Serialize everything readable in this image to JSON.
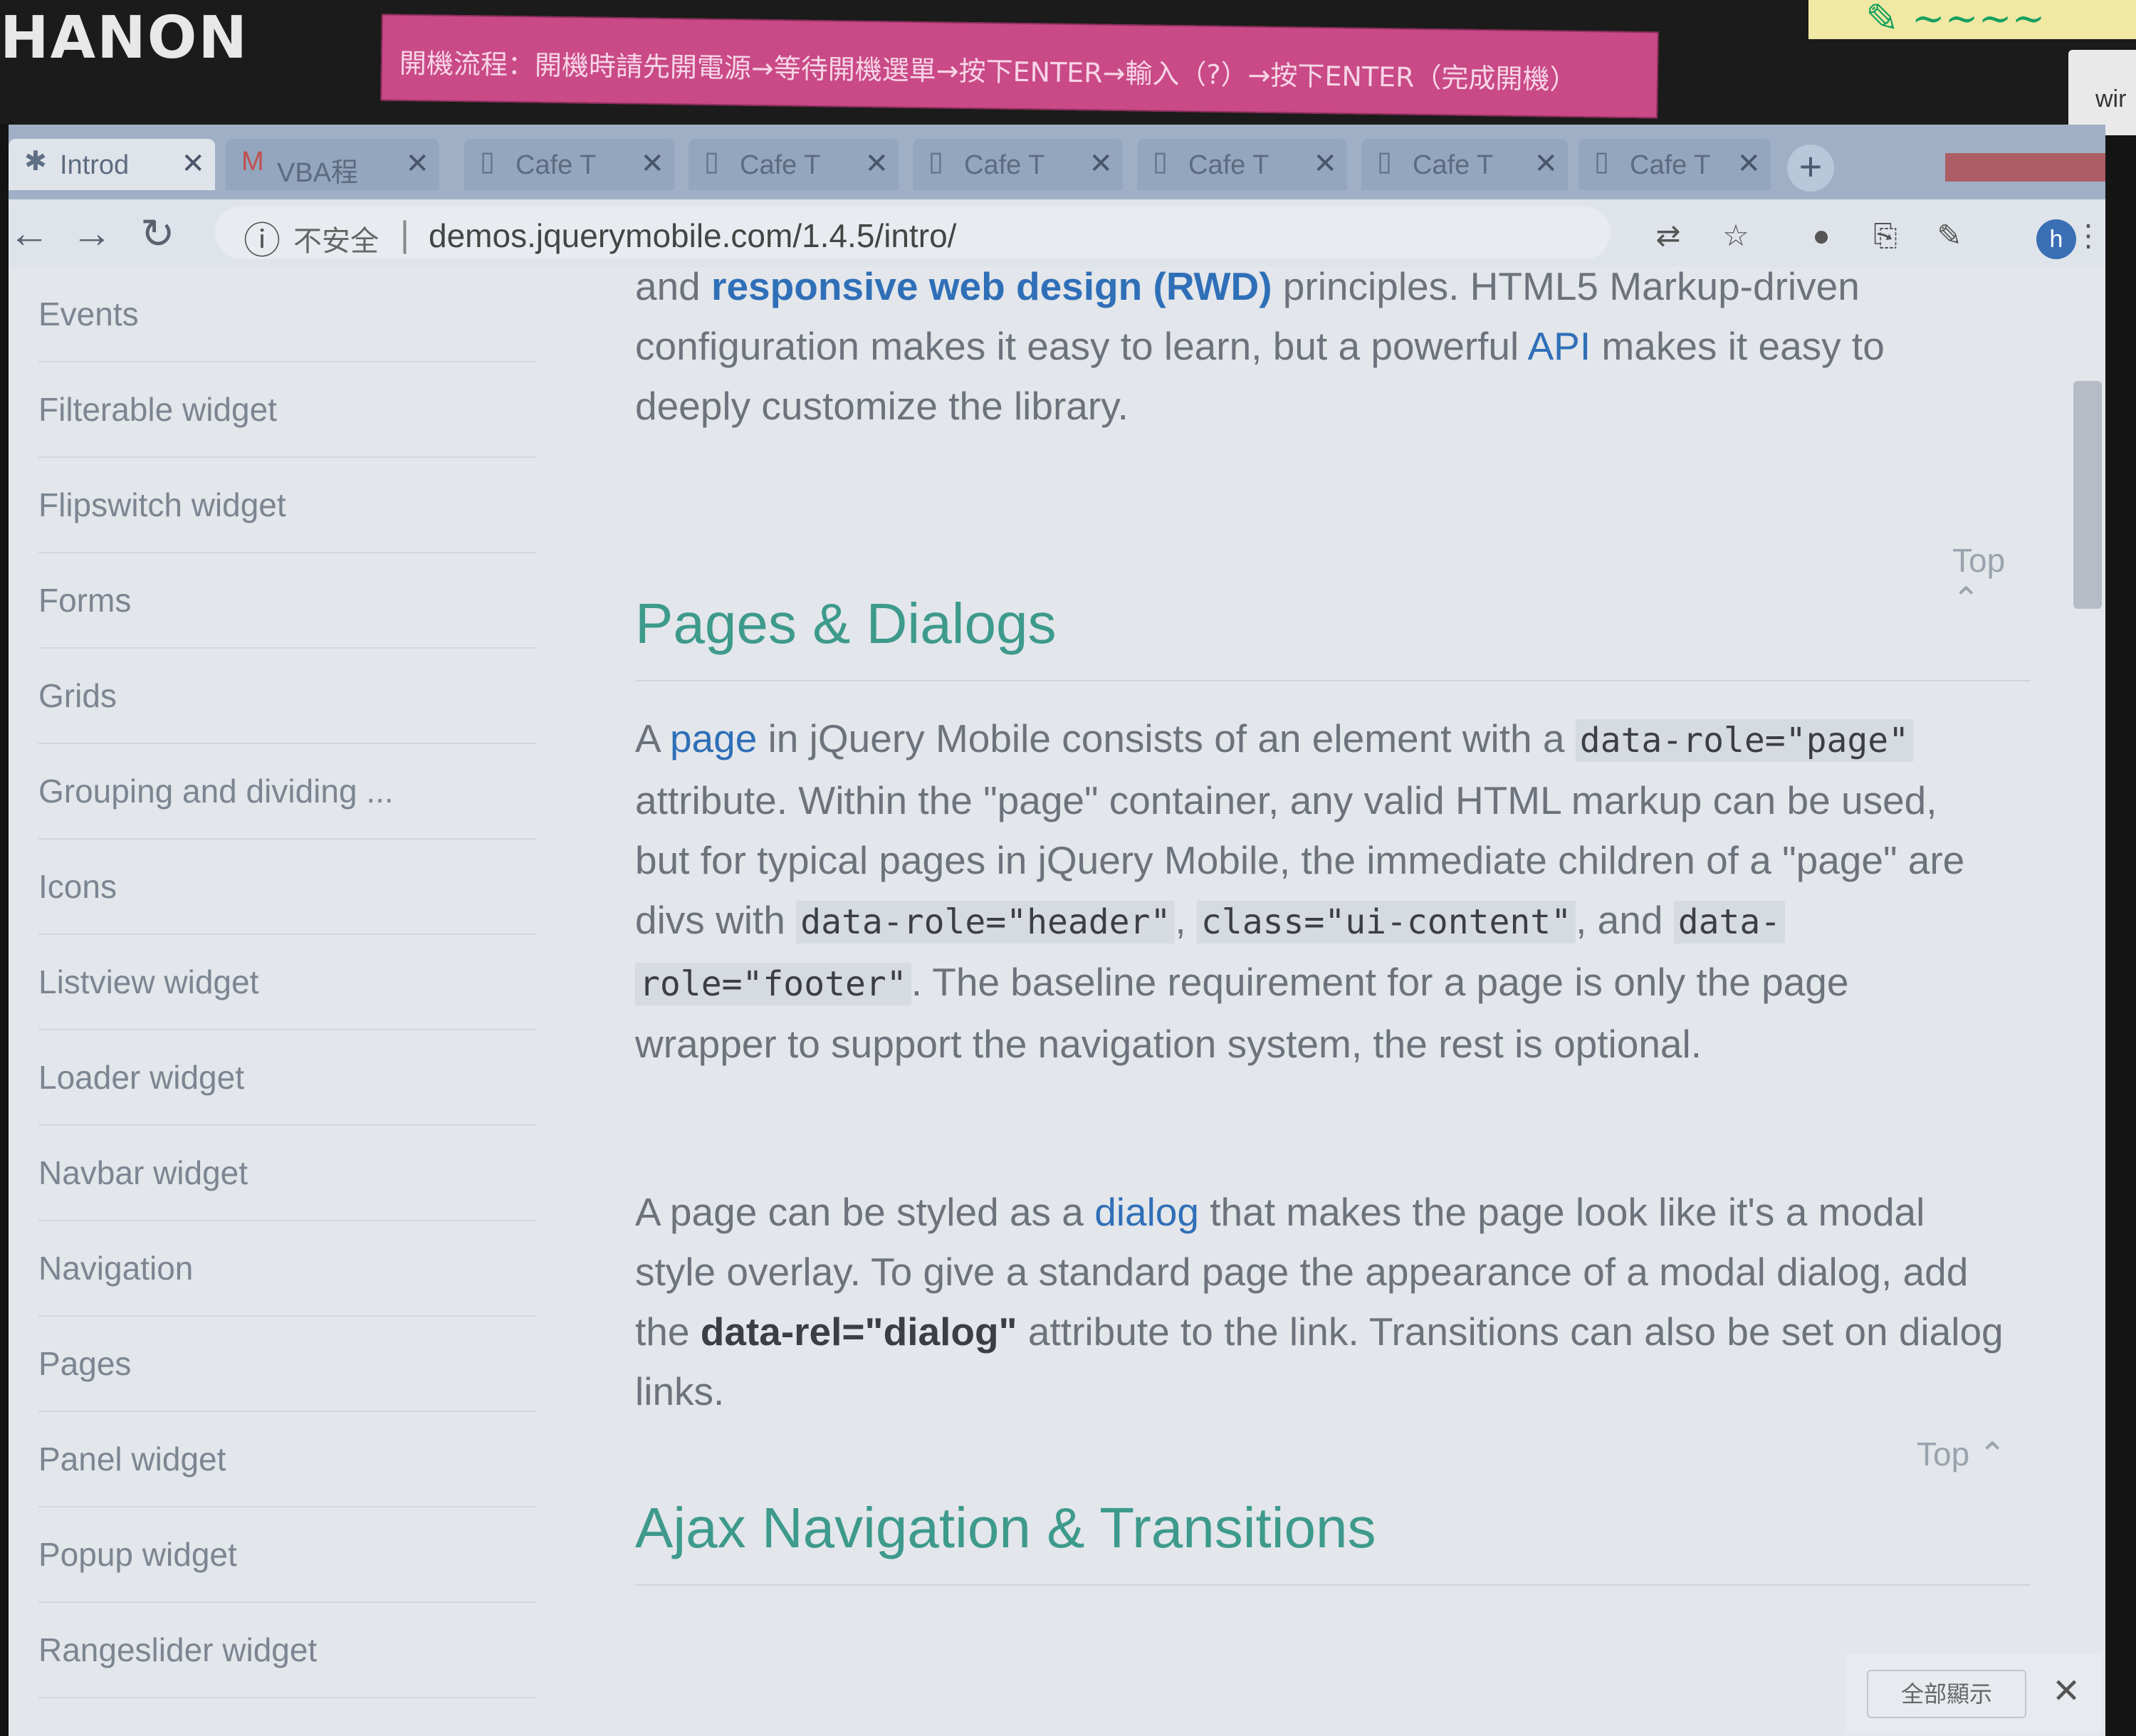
{
  "monitor": {
    "brand": "HANON"
  },
  "sticky_note": {
    "text": "開機流程：開機時請先開電源→等待開機選單→按下ENTER→輸入（?）→按下ENTER（完成開機）"
  },
  "background_window": {
    "label": "wir"
  },
  "tabs": [
    {
      "label": "Introd",
      "icon": "jquery-icon",
      "active": true
    },
    {
      "label": "VBA程",
      "icon": "gmail-icon"
    },
    {
      "label": "Cafe T",
      "icon": "page-icon"
    },
    {
      "label": "Cafe T",
      "icon": "page-icon"
    },
    {
      "label": "Cafe T",
      "icon": "page-icon"
    },
    {
      "label": "Cafe T",
      "icon": "page-icon"
    },
    {
      "label": "Cafe T",
      "icon": "page-icon"
    },
    {
      "label": "Cafe T",
      "icon": "page-icon"
    }
  ],
  "tab_close_glyph": "✕",
  "new_tab_glyph": "+",
  "address_bar": {
    "security_label": "不安全",
    "url": "demos.jquerymobile.com/1.4.5/intro/"
  },
  "profile_initial": "h",
  "sidebar": {
    "items": [
      "Events",
      "Filterable widget",
      "Flipswitch widget",
      "Forms",
      "Grids",
      "Grouping and dividing ...",
      "Icons",
      "Listview widget",
      "Loader widget",
      "Navbar widget",
      "Navigation",
      "Pages",
      "Panel widget",
      "Popup widget",
      "Rangeslider widget"
    ]
  },
  "content": {
    "intro": {
      "p1a": "and ",
      "p1_link": "responsive web design (RWD)",
      "p1b": " principles. HTML5 Markup-driven",
      "p2a": "configuration makes it easy to learn, but a powerful ",
      "p2_link": "API",
      "p2b": " makes it easy to",
      "p3": "deeply customize the library."
    },
    "top_label": "Top",
    "pages_heading": "Pages & Dialogs",
    "pages_para": {
      "a": "A ",
      "link": "page",
      "b": " in jQuery Mobile consists of an element with a ",
      "code1": "data-role=\"page\"",
      "c": "attribute. Within the \"page\" container, any valid HTML markup can be used,",
      "d": "but for typical pages in jQuery Mobile, the immediate children of a \"page\" are",
      "e": "divs with ",
      "code2": "data-role=\"header\"",
      "f": ", ",
      "code3": "class=\"ui-content\"",
      "g": ", and ",
      "code4a": "data-",
      "code4b": "role=\"footer\"",
      "h": ". The baseline requirement for a page is only the page",
      "i": "wrapper to support the navigation system, the rest is optional."
    },
    "dialog_para": {
      "a": "A page can be styled as a ",
      "link": "dialog",
      "b": " that makes the page look like it's a modal",
      "c": "style overlay. To give a standard page the appearance of a modal dialog, add",
      "d": "the ",
      "attr": "data-rel=\"dialog\"",
      "e": " attribute to the link. Transitions can also be set on dialog",
      "f": "links."
    },
    "ajax_heading": "Ajax Navigation & Transitions"
  },
  "download_bar": {
    "show_all": "全部顯示"
  }
}
